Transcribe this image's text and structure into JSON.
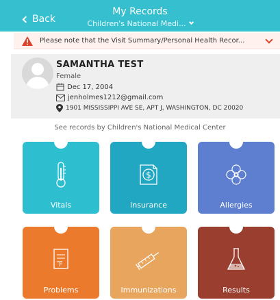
{
  "header": {
    "back_label": "Back",
    "title": "My Records",
    "subtitle": "Children's National Medi..."
  },
  "notice": {
    "text": "Please note that the Visit Summary/Personal Health Recor...",
    "accent_color": "#d9432b"
  },
  "patient": {
    "name": "SAMANTHA TEST",
    "gender": "Female",
    "dob": "Dec 17, 2004",
    "email": "jenholmes1212@gmail.com",
    "address": "1901 MISSISSIPPI AVE SE, APT J, WASHINGTON, DC 20020"
  },
  "records_caption": "See records by Children's National Medical Center",
  "tiles": [
    {
      "label": "Vitals",
      "icon": "thermometer-icon",
      "color": "#2dbfd0"
    },
    {
      "label": "Insurance",
      "icon": "dollar-document-icon",
      "color": "#22a7c2"
    },
    {
      "label": "Allergies",
      "icon": "flower-icon",
      "color": "#5e7fd0"
    },
    {
      "label": "Problems",
      "icon": "clipboard-icon",
      "color": "#ec7a2d"
    },
    {
      "label": "Immunizations",
      "icon": "syringe-icon",
      "color": "#e8a55e"
    },
    {
      "label": "Results",
      "icon": "flask-icon",
      "color": "#9a3f2f"
    }
  ],
  "colors": {
    "header": "#36bfcf",
    "profile_bg": "#efefef"
  }
}
